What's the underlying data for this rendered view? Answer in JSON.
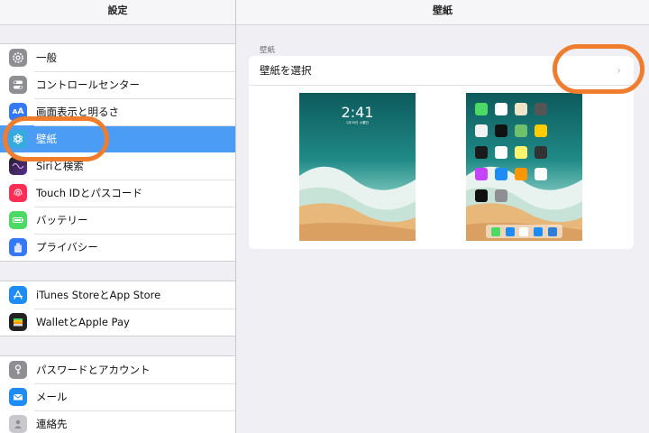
{
  "sidebar": {
    "title": "設定",
    "group1": [
      {
        "label": "一般",
        "icon": "gear-icon",
        "color": "#8e8e93"
      },
      {
        "label": "コントロールセンター",
        "icon": "toggles-icon",
        "color": "#8e8e93"
      },
      {
        "label": "画面表示と明るさ",
        "icon": "text-size-icon",
        "color": "#3478f6"
      },
      {
        "label": "壁紙",
        "icon": "flower-icon",
        "color": "#35aadc",
        "selected": true
      },
      {
        "label": "Siriと検索",
        "icon": "siri-icon",
        "color": "#222"
      },
      {
        "label": "Touch IDとパスコード",
        "icon": "fingerprint-icon",
        "color": "#fe2d55"
      },
      {
        "label": "バッテリー",
        "icon": "battery-icon",
        "color": "#4cd964"
      },
      {
        "label": "プライバシー",
        "icon": "hand-icon",
        "color": "#3478f6"
      }
    ],
    "group2": [
      {
        "label": "iTunes StoreとApp Store",
        "icon": "app-store-icon",
        "color": "#1d8df5"
      },
      {
        "label": "WalletとApple Pay",
        "icon": "wallet-icon",
        "color": "#222"
      }
    ],
    "group3": [
      {
        "label": "パスワードとアカウント",
        "icon": "key-icon",
        "color": "#8e8e93"
      },
      {
        "label": "メール",
        "icon": "mail-icon",
        "color": "#1d8df5"
      },
      {
        "label": "連絡先",
        "icon": "contacts-icon",
        "color": "#b0b0b4"
      }
    ]
  },
  "main": {
    "title": "壁紙",
    "section_title": "壁紙",
    "choose_label": "壁紙を選択",
    "lock_time": "2:41",
    "lock_date": "1月30日 火曜日"
  },
  "colors": {
    "accent": "#4a9cf5",
    "highlight": "#f07d2e"
  }
}
